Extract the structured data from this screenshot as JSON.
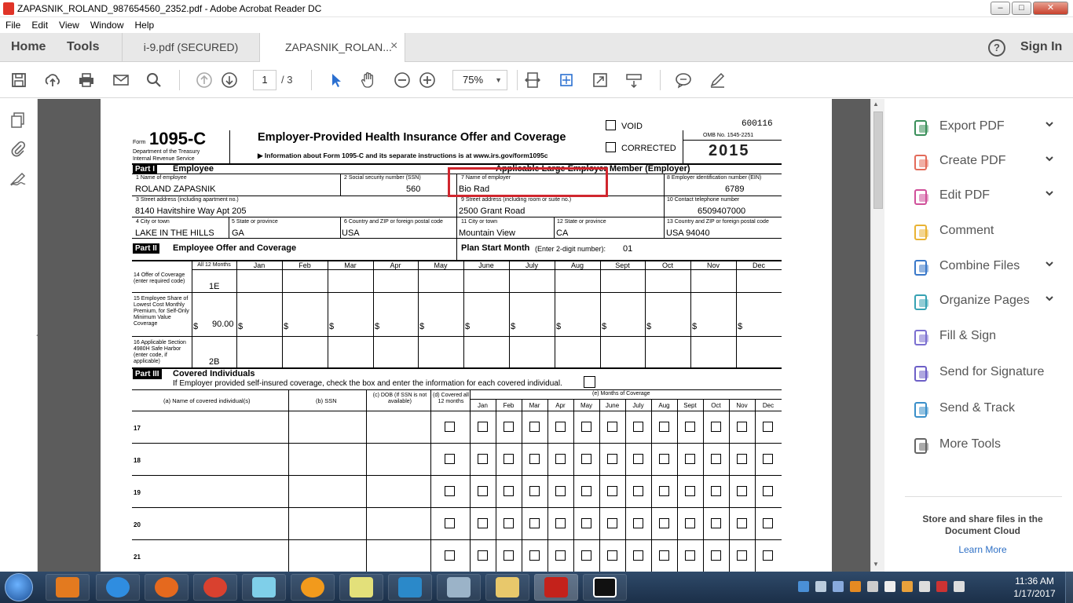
{
  "window": {
    "title": "ZAPASNIK_ROLAND_987654560_2352.pdf - Adobe Acrobat Reader DC",
    "min": "–",
    "max": "□",
    "close": "✕"
  },
  "menu": [
    "File",
    "Edit",
    "View",
    "Window",
    "Help"
  ],
  "tabs": {
    "home": "Home",
    "tools": "Tools",
    "doc1": "i-9.pdf (SECURED)",
    "doc2": "ZAPASNIK_ROLAN...",
    "close": "×",
    "help": "?",
    "signin": "Sign In"
  },
  "toolbar": {
    "page_current": "1",
    "page_total": "/ 3",
    "zoom": "75%"
  },
  "rightpane": {
    "items": [
      {
        "label": "Export PDF",
        "icon": "export-pdf-icon",
        "color": "#3a8f5a",
        "chev": true
      },
      {
        "label": "Create PDF",
        "icon": "create-pdf-icon",
        "color": "#e36b5a",
        "chev": true
      },
      {
        "label": "Edit PDF",
        "icon": "edit-pdf-icon",
        "color": "#d0509a",
        "chev": true
      },
      {
        "label": "Comment",
        "icon": "comment-icon",
        "color": "#e9b334",
        "chev": false
      },
      {
        "label": "Combine Files",
        "icon": "combine-files-icon",
        "color": "#3a78c9",
        "chev": true
      },
      {
        "label": "Organize Pages",
        "icon": "organize-pages-icon",
        "color": "#37a2b3",
        "chev": true
      },
      {
        "label": "Fill & Sign",
        "icon": "fill-sign-icon",
        "color": "#7b6fd0",
        "chev": false
      },
      {
        "label": "Send for Signature",
        "icon": "send-signature-icon",
        "color": "#6d5fc7",
        "chev": false
      },
      {
        "label": "Send & Track",
        "icon": "send-track-icon",
        "color": "#3a8fc9",
        "chev": false
      },
      {
        "label": "More Tools",
        "icon": "more-tools-icon",
        "color": "#666",
        "chev": false
      }
    ],
    "cloud_text": "Store and share files in the Document Cloud",
    "learn_more": "Learn More"
  },
  "form": {
    "form_word": "Form",
    "form_number": "1095-C",
    "dept": "Department of the Treasury",
    "irs": "Internal Revenue Service",
    "title": "Employer-Provided Health Insurance Offer and Coverage",
    "info": "▶ Information about Form 1095-C and its separate instructions is at www.irs.gov/form1095c",
    "void": "VOID",
    "corrected": "CORRECTED",
    "code": "600116",
    "omb": "OMB No. 1545-2251",
    "year": "2015",
    "part1": "Part I",
    "part1_title": "Employee",
    "employer_member": "Applicable Large Employer Member (Employer)",
    "l1": "1 Name of employee",
    "v1": "ROLAND ZAPASNIK",
    "l2": "2 Social security number (SSN)",
    "v2": "560",
    "l7": "7 Name of employer",
    "v7": "Bio Rad",
    "l8": "8 Employer identification number (EIN)",
    "v8": "6789",
    "l3": "3 Street address (including apartment no.)",
    "v3": "8140 Havitshire Way Apt 205",
    "l9": "9 Street address (including room or suite no.)",
    "v9": "2500 Grant Road",
    "l10": "10 Contact telephone number",
    "v10": "6509407000",
    "l4": "4 City or town",
    "v4": "LAKE IN THE HILLS",
    "l5": "5 State or province",
    "v5": "GA",
    "l6": "6 Country and ZIP or foreign postal code",
    "v6": "USA",
    "l11": "11 City or town",
    "v11": "Mountain View",
    "l12": "12 State or province",
    "v12": "CA",
    "l13": "13 Country and ZIP or foreign postal code",
    "v13": "USA 94040",
    "part2": "Part II",
    "part2_title": "Employee Offer and Coverage",
    "plan_start": "Plan Start Month",
    "plan_start_note": "(Enter 2-digit number):",
    "plan_start_val": "01",
    "months_header": [
      "All 12 Months",
      "Jan",
      "Feb",
      "Mar",
      "Apr",
      "May",
      "June",
      "July",
      "Aug",
      "Sept",
      "Oct",
      "Nov",
      "Dec"
    ],
    "r14": "14 Offer of Coverage (enter required code)",
    "v14": "1E",
    "r15": "15 Employee Share of Lowest Cost Monthly Premium, for Self-Only Minimum Value Coverage",
    "v15": "90.00",
    "dollar": "$",
    "r16": "16 Applicable Section 4980H Safe Harbor (enter code, if applicable)",
    "v16": "2B",
    "part3": "Part III",
    "part3_title": "Covered Individuals",
    "part3_note": "If Employer provided self-insured coverage, check the box and enter the information for each covered individual.",
    "c_a": "(a) Name of covered individual(s)",
    "c_b": "(b) SSN",
    "c_c": "(c) DOB (If SSN is not available)",
    "c_d": "(d) Covered all 12 months",
    "c_e": "(e) Months of Coverage",
    "months_short": [
      "Jan",
      "Feb",
      "Mar",
      "Apr",
      "May",
      "June",
      "July",
      "Aug",
      "Sept",
      "Oct",
      "Nov",
      "Dec"
    ],
    "rows": [
      "17",
      "18",
      "19",
      "20",
      "21"
    ]
  },
  "taskbar": {
    "time": "11:36 AM",
    "date": "1/17/2017"
  }
}
